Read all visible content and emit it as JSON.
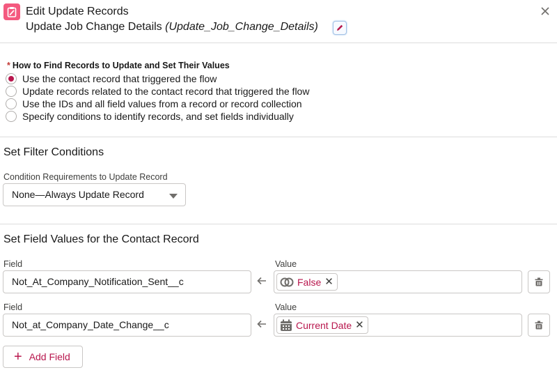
{
  "header": {
    "title": "Edit Update Records",
    "element_label": "Update Job Change Details",
    "element_api_name": "(Update_Job_Change_Details)",
    "app_icon": "clipboard-pencil-icon",
    "edit_icon": "pencil-icon",
    "close_icon": "close-icon"
  },
  "find_records": {
    "required_marker": "*",
    "label": "How to Find Records to Update and Set Their Values",
    "options": [
      {
        "label": "Use the contact record that triggered the flow",
        "selected": true
      },
      {
        "label": "Update records related to the contact record that triggered the flow",
        "selected": false
      },
      {
        "label": "Use the IDs and all field values from a record or record collection",
        "selected": false
      },
      {
        "label": "Specify conditions to identify records, and set fields individually",
        "selected": false
      }
    ]
  },
  "filter": {
    "title": "Set Filter Conditions",
    "condition_label": "Condition Requirements to Update Record",
    "condition_value": "None—Always Update Record"
  },
  "field_values": {
    "title": "Set Field Values for the Contact Record",
    "rows": [
      {
        "field_label": "Field",
        "field_value": "Not_At_Company_Notification_Sent__c",
        "value_label": "Value",
        "value_pill": "False",
        "value_icon": "boolean-icon"
      },
      {
        "field_label": "Field",
        "field_value": "Not_at_Company_Date_Change__c",
        "value_label": "Value",
        "value_pill": "Current Date",
        "value_icon": "calendar-icon"
      }
    ],
    "add_label": "Add Field"
  },
  "colors": {
    "brand_pink": "#f4597f",
    "accent": "#b8174d",
    "border": "#c9c7c5"
  }
}
